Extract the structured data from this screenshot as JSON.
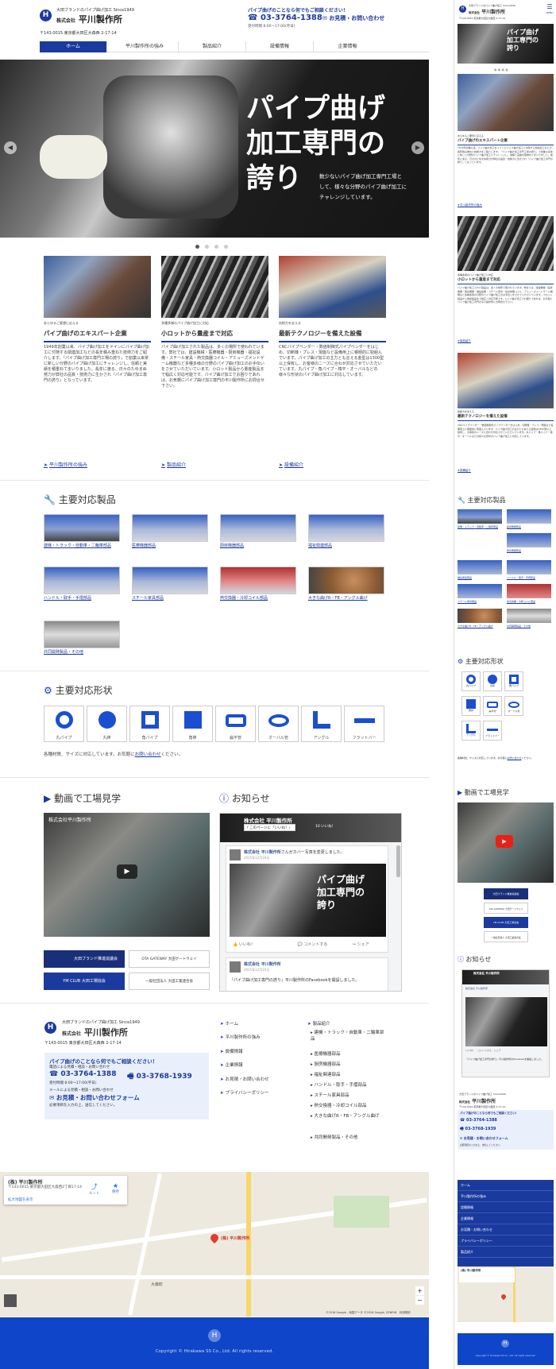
{
  "header": {
    "tagline": "大田ブランドのパイプ曲げ加工 Since1949",
    "company_prefix": "株式会社",
    "company_name": "平川製作所",
    "address": "〒143-0015 東京都大田区大森西 2-17-14",
    "cta_text": "パイプ曲げのことなら何でもご相談ください！",
    "phone": "03-3764-1388",
    "hours": "受付時間 8:00～17:00(平日)",
    "estimate": "お見積・お問い合わせ",
    "logo_letter": "H"
  },
  "nav": [
    "ホーム",
    "平川製作所の強み",
    "製品紹介",
    "設備情報",
    "企業情報"
  ],
  "hero": {
    "title_line1": "パイプ曲げ",
    "title_line2": "加工専門の",
    "title_line3": "誇り",
    "sub1": "数少ないパイプ曲げ加工専門工場と",
    "sub2": "して、様々な分野のパイプ曲げ加工に",
    "sub3": "チャレンジしています。"
  },
  "features": [
    {
      "kicker": "あらゆるご要望に応える",
      "title": "パイプ曲げのエキスパート企業",
      "text": "1949年創業以来、パイプ曲げ加工をメインにパイプ曲げ加工に付随する関連加工などの長年積み重ねた技術力をご紹介します。『パイプ曲げ加工専門工場の誇り』で創業以来常に新しい分野のパイプ曲げ加工にチャレンジし、信頼と実績を積重ねてまいりました。長年に渡る、日々のたゆまぬ努力が弊社の品質・技術力に生かされ『パイプ曲げ加工専門の誇り』となっています。",
      "link": "平川製作所の強み"
    },
    {
      "kicker": "多種多様のパイプ曲げ加工に対応",
      "title": "小ロットから量産まで対応",
      "text": "パイプ曲げ加工された製品は、多くの場所で使われています。弊社では、建設機械・医療機器・厨房機器・福祉設備・スチール家具・熱交換器コイル・アミューズメントゲーム機器など多種多様の分野のパイプ曲げ加工のお手伝いをさせていただいています。小ロット製品から量産製品まで幅広く対応可能です。パイプ曲げ加工でお困りであれば、お気軽にパイプ曲げ加工専門の平川製作所にお問合せ下さい。",
      "link": "製品紹介"
    },
    {
      "kicker": "技術力を支える",
      "title": "最新テクノロジーを備えた設備",
      "text": "CNCパイプベンダー・数値制御式パイプベンダーをはじめ、切断機・プレス・現盤など設備用上に積極的に取組んでいます。パイプ曲げ加工の主力とも言える金型は1300型以上保有し、お客様のニーズに合わせ対応させていただいています。丸パイプ・角パイプ・楕平・オーバルなどの様々な形状のパイプ曲げ加工に対応しています。",
      "link": "設備紹介"
    }
  ],
  "products": {
    "heading": "主要対応製品",
    "items": [
      "建機・トラック・自動車・二輪車部品",
      "医療機器部品",
      "厨房機器部品",
      "福祉関連部品",
      "ハンドル・取手・手摺部品",
      "スチール家具部品",
      "熱交換器・冷却コイル部品",
      "大きな曲げR・FB・アングル曲げ",
      "共同開発製品・その他"
    ]
  },
  "shapes": {
    "heading": "主要対応形状",
    "items": [
      "丸パイプ",
      "丸棒",
      "角パイプ",
      "角棒",
      "扁平管",
      "オーバル管",
      "アングル",
      "フラットバー"
    ],
    "note_pre": "各種材質、サイズに対応しています。お気軽に",
    "note_link": "お問い合わせ",
    "note_post": "ください。"
  },
  "video": {
    "heading": "動画で工場見学",
    "title": "株式会社平川製作所",
    "banners": [
      "大田ブランド推進協議会",
      "OTA GATEWAY 大田ゲートウェイ",
      "YM CLUB 大田工場協会",
      "一般社団法人 大田工業連合会"
    ]
  },
  "news": {
    "heading": "お知らせ",
    "page": "株式会社 平川製作所",
    "likes": "10 いいね！",
    "like_btn": "このページに「いいね！」",
    "post1_name": "株式会社 平川製作所",
    "post1_action": "さんがカバー写真を変更しました。",
    "post1_date": "2015年12月16日",
    "like": "いいね！",
    "comment": "コメントする",
    "share": "シェア",
    "post2_name": "株式会社 平川製作所",
    "post2_date": "2015年12月16日",
    "post2_text": "『パイプ曲げ加工専門の誇り』平川製作所のFacebookを開設しました。"
  },
  "footer": {
    "tagline": "大田ブランドのパイプ曲げ加工 Since1949",
    "company_prefix": "株式会社",
    "company_name": "平川製作所",
    "address": "〒143-0015 東京都大田区大森西 2-17-14",
    "cta_title": "パイプ曲げのことなら何でもご相談ください！",
    "cta_sub": "電話による見積・相談・お問い合わせ",
    "phone": "03-3764-1388",
    "fax": "03-3768-1939",
    "hours": "受付時間 8:00～17:00(平日)",
    "mail_sub": "メールによる見積・相談・お問い合わせ",
    "form": "お見積・お問い合わせフォーム",
    "form_note": "必要項目を入力の上、送信してください。",
    "links1": [
      "ホーム",
      "平川製作所の強み",
      "設備情報",
      "企業情報",
      "お見積・お問い合わせ",
      "プライバシーポリシー"
    ],
    "links2_title": "製品紹介",
    "links2": [
      "建機・トラック・自動車・二輪車部品",
      "医療機器部品",
      "厨房機器部品",
      "福祉関連部品",
      "ハンドル・取手・手摺部品",
      "スチール家具部品",
      "熱交換器・冷却コイル部品",
      "大きな曲げR・FB・アングル曲げ",
      "共同開発製品・その他"
    ]
  },
  "map": {
    "name": "(株) 平川製作所",
    "addr": "〒143-0015 東京都大田区大森西2丁目17-14",
    "enlarge": "拡大地図を表示",
    "route": "ルート",
    "save": "保存",
    "pin_label": "(株) 平川製作所",
    "station": "大森町",
    "copyright": "©2016 Google - 地図データ ©2016 Google, ZENRIN　利用規約"
  },
  "copyright": "Copyright © Hirakawa SS Co., Ltd. All rights reserved.",
  "mobile": {
    "menu": "MENU",
    "nav": [
      "ホーム",
      "平川製作所の強み",
      "設備情報",
      "企業情報",
      "お見積・お問い合わせ",
      "プライバシーポリシー",
      "製品紹介"
    ]
  }
}
